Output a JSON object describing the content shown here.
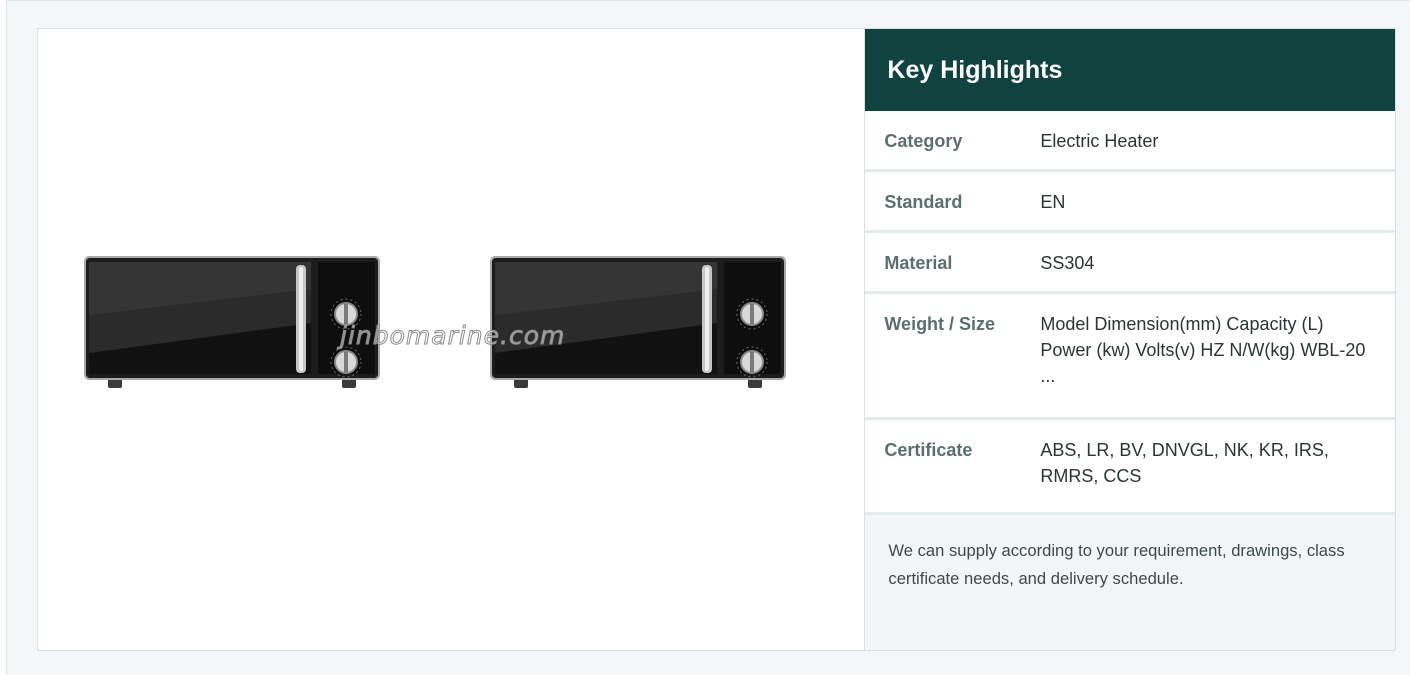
{
  "product": {
    "watermark": "jinbomarine.com",
    "photos": [
      {
        "icon": "microwave-oven-front-view"
      },
      {
        "icon": "microwave-oven-front-view"
      }
    ]
  },
  "highlights": {
    "title": "Key Highlights",
    "rows": [
      {
        "label": "Category",
        "value": "Electric Heater"
      },
      {
        "label": "Standard",
        "value": "EN"
      },
      {
        "label": "Material",
        "value": "SS304"
      },
      {
        "label": "Weight / Size",
        "value": "Model  Dimension(mm) Capacity (L) Power (kw) Volts(v) HZ N/W(kg) WBL-20 ..."
      },
      {
        "label": "Certificate",
        "value": "ABS, LR, BV, DNVGL, NK, KR, IRS, RMRS, CCS"
      }
    ],
    "note": "We can supply according to your requirement, drawings, class certificate needs, and delivery schedule."
  },
  "colors": {
    "header_bg": "#10433f",
    "label_text": "#5c6e6e",
    "note_bg": "#f2f6f6"
  }
}
